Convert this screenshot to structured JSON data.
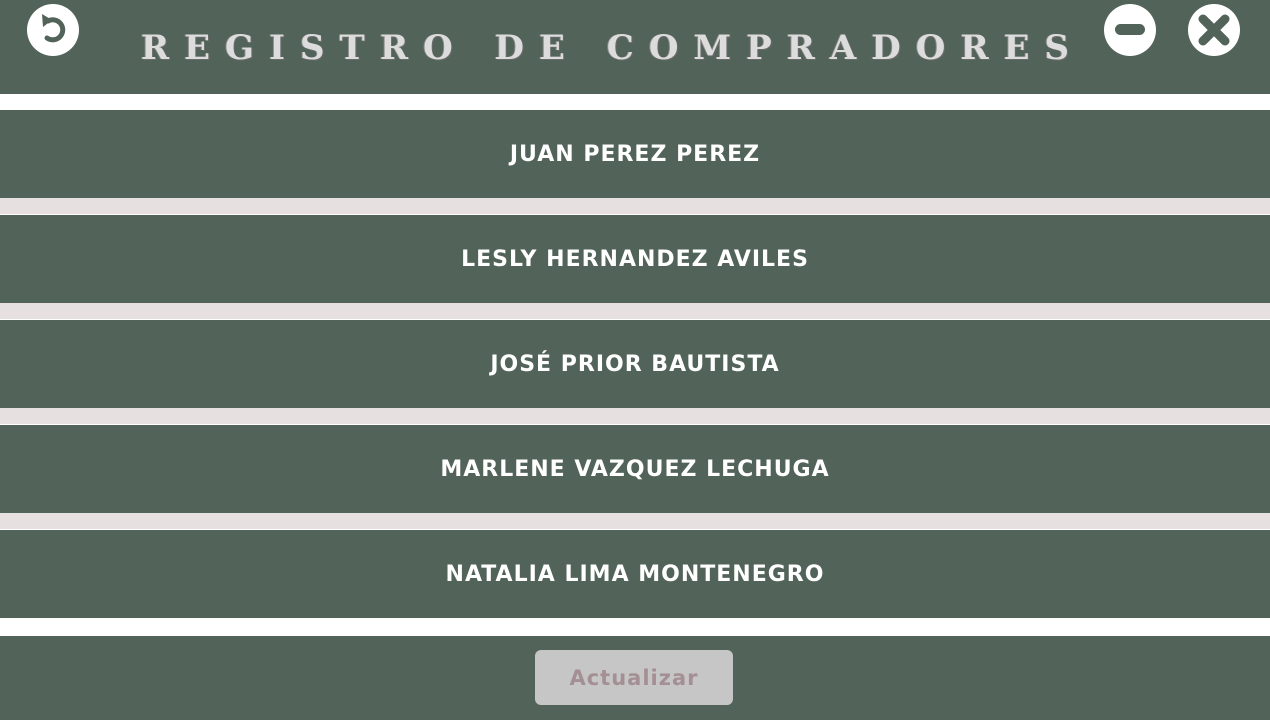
{
  "header": {
    "title": "REGISTRO DE COMPRADORES",
    "back_icon": "undo-arrow-icon",
    "minimize_icon": "minus-circle-icon",
    "close_icon": "close-x-icon"
  },
  "buyers": [
    {
      "name": "JUAN PEREZ PEREZ"
    },
    {
      "name": "LESLY HERNANDEZ AVILES"
    },
    {
      "name": "JOSÉ PRIOR BAUTISTA"
    },
    {
      "name": "MARLENE VAZQUEZ LECHUGA"
    },
    {
      "name": "NATALIA LIMA MONTENEGRO"
    }
  ],
  "footer": {
    "update_label": "Actualizar"
  },
  "colors": {
    "panel": "#526359",
    "separator": "#e6e1e0",
    "button_bg": "#c6c6c6",
    "button_text": "#a38f94",
    "icon_bg": "#ffffff"
  }
}
